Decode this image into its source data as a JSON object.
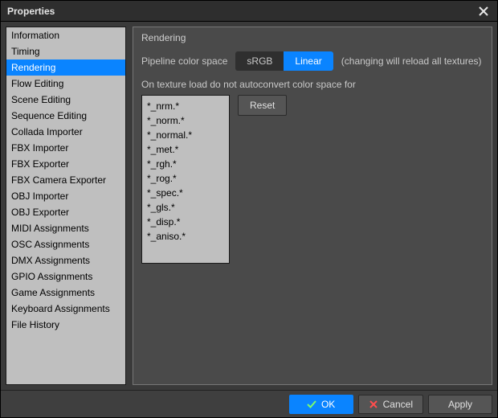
{
  "window": {
    "title": "Properties"
  },
  "sidebar": {
    "items": [
      "Information",
      "Timing",
      "Rendering",
      "Flow Editing",
      "Scene Editing",
      "Sequence Editing",
      "Collada Importer",
      "FBX Importer",
      "FBX Exporter",
      "FBX Camera Exporter",
      "OBJ Importer",
      "OBJ Exporter",
      "MIDI Assignments",
      "OSC Assignments",
      "DMX Assignments",
      "GPIO Assignments",
      "Game Assignments",
      "Keyboard Assignments",
      "File History"
    ],
    "selected_index": 2
  },
  "panel": {
    "title": "Rendering",
    "color_space": {
      "label": "Pipeline color space",
      "options": [
        "sRGB",
        "Linear"
      ],
      "selected_index": 1,
      "hint": "(changing will reload all textures)"
    },
    "no_autoconvert": {
      "label": "On texture load do not autoconvert color space for",
      "patterns": "*_nrm.*\n*_norm.*\n*_normal.*\n*_met.*\n*_rgh.*\n*_rog.*\n*_spec.*\n*_gls.*\n*_disp.*\n*_aniso.*",
      "reset_label": "Reset"
    }
  },
  "footer": {
    "ok": "OK",
    "cancel": "Cancel",
    "apply": "Apply"
  }
}
